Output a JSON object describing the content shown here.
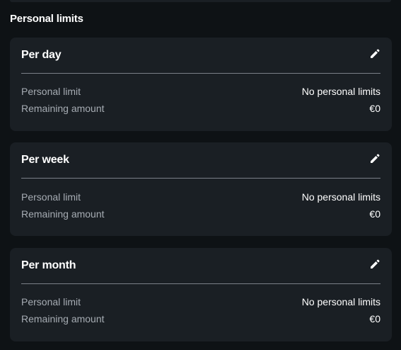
{
  "section": {
    "title": "Personal limits"
  },
  "cards": [
    {
      "title": "Per day",
      "edit_icon": "pencil-icon",
      "rows": [
        {
          "label": "Personal limit",
          "value": "No personal limits"
        },
        {
          "label": "Remaining amount",
          "value": "€0"
        }
      ]
    },
    {
      "title": "Per week",
      "edit_icon": "pencil-icon",
      "rows": [
        {
          "label": "Personal limit",
          "value": "No personal limits"
        },
        {
          "label": "Remaining amount",
          "value": "€0"
        }
      ]
    },
    {
      "title": "Per month",
      "edit_icon": "pencil-icon",
      "rows": [
        {
          "label": "Personal limit",
          "value": "No personal limits"
        },
        {
          "label": "Remaining amount",
          "value": "€0"
        }
      ]
    }
  ],
  "colors": {
    "background": "#0e1215",
    "card": "#1a1f24",
    "text_primary": "#ffffff",
    "text_secondary": "#a6acb3",
    "divider": "#7a8088"
  }
}
